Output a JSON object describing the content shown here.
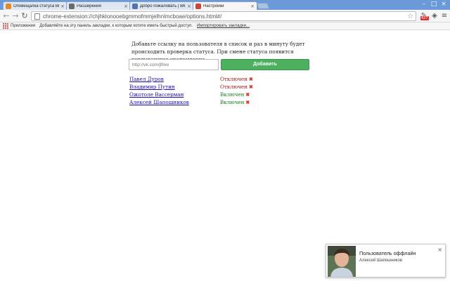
{
  "browser": {
    "tabs": [
      {
        "title": "Оповещалка статуса ВК: з",
        "favicon_color": "#e08a2a"
      },
      {
        "title": "Расширения",
        "favicon_color": "#6a6a6a"
      },
      {
        "title": "Добро пожаловать | ВКон",
        "favicon_color": "#4a76a8"
      },
      {
        "title": "Настройки",
        "favicon_color": "#c4483b"
      }
    ],
    "tab_close_icon": "×",
    "url": "chrome-extension://chjhklonooebgmmofmmjelhnlmcboae/options.html#/",
    "extension_badge": "427",
    "bookmarks": {
      "apps_label": "Приложения",
      "hint_text": "Добавляйте на эту панель закладки, к которым хотите иметь быстрый доступ.",
      "import_link": "Импортировать закладки..."
    }
  },
  "page": {
    "intro_text": "Добавьте ссылку на пользователя в список и раз в минуту будет происходить проверка статуса. При смене статуса появится всплывающее уведомление",
    "input_placeholder": "http://vk.com/jlfrev",
    "add_button_label": "Добавить",
    "users": [
      {
        "name": "Павел Дуров",
        "status": "Отключен",
        "state": "offline"
      },
      {
        "name": "Владимир Путин",
        "status": "Отключен",
        "state": "offline"
      },
      {
        "name": "Ожотоле Вассерман",
        "status": "Включен",
        "state": "online"
      },
      {
        "name": "Алексей Шапошников",
        "status": "Включен",
        "state": "online"
      }
    ],
    "remove_icon": "✖"
  },
  "notification": {
    "title": "Пользователь оффлайн",
    "body": "Алексей Шапошников",
    "close_icon": "×"
  },
  "colors": {
    "accent_green": "#4cb05f",
    "offline_red": "#a31a1a",
    "online_green": "#1e7b1e",
    "link_blue": "#1a0dab"
  }
}
